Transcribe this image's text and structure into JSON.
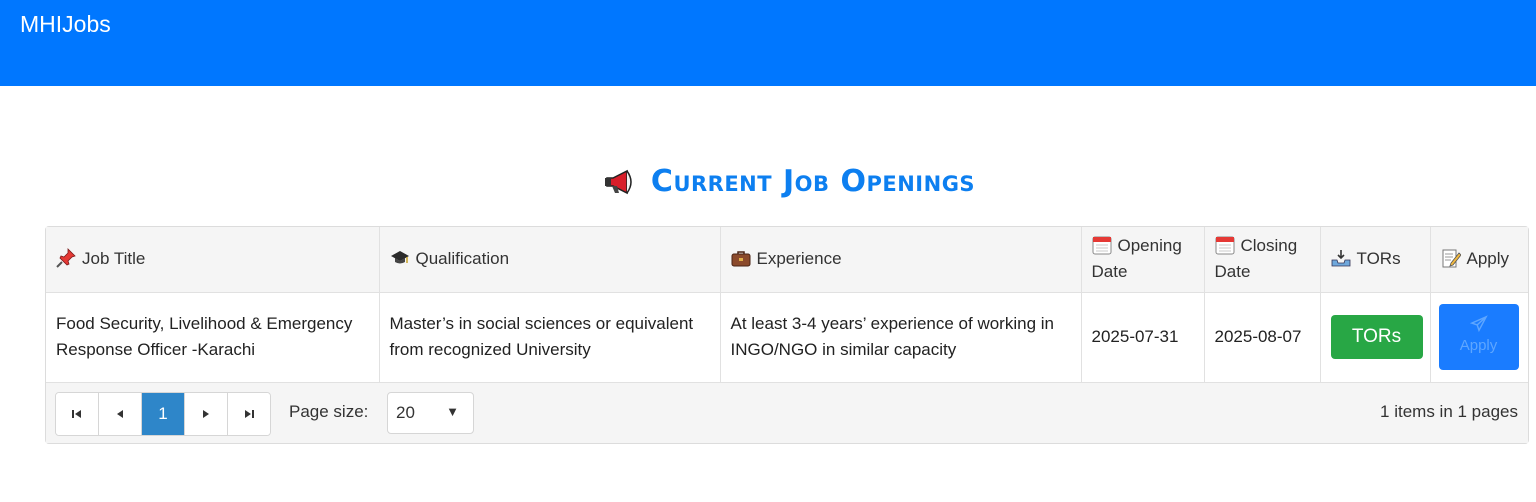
{
  "navbar": {
    "brand": "MHIJobs"
  },
  "page": {
    "title": "Current Job Openings",
    "title_icon": "megaphone-icon"
  },
  "table": {
    "columns": [
      {
        "label": "Job Title",
        "icon": "pushpin-icon"
      },
      {
        "label": "Qualification",
        "icon": "graduation-cap-icon"
      },
      {
        "label": "Experience",
        "icon": "briefcase-icon"
      },
      {
        "label": "Opening Date",
        "icon": "calendar-icon"
      },
      {
        "label": "Closing Date",
        "icon": "calendar-icon"
      },
      {
        "label": "TORs",
        "icon": "inbox-tray-icon"
      },
      {
        "label": "Apply",
        "icon": "memo-icon"
      }
    ],
    "rows": [
      {
        "job_title": "Food Security, Livelihood & Emergency Response Officer -Karachi",
        "qualification": "Master’s in social sciences or equivalent from recognized University",
        "experience": "At least 3-4 years’ experience of working in INGO/NGO in similar capacity",
        "opening_date": "2025-07-31",
        "closing_date": "2025-08-07",
        "tors_label": "TORs",
        "apply_label": "Apply"
      }
    ]
  },
  "pager": {
    "first": "⏮",
    "prev": "◀",
    "current_page": "1",
    "next": "▶",
    "last": "⏭",
    "page_size_label": "Page size:",
    "page_size": "20",
    "info": "1 items in 1 pages"
  },
  "colors": {
    "navbar": "#0077ff",
    "title": "#0d7ff0",
    "tors_button": "#28a745",
    "apply_button": "#1a7cff",
    "active_page": "#2e86c9"
  }
}
